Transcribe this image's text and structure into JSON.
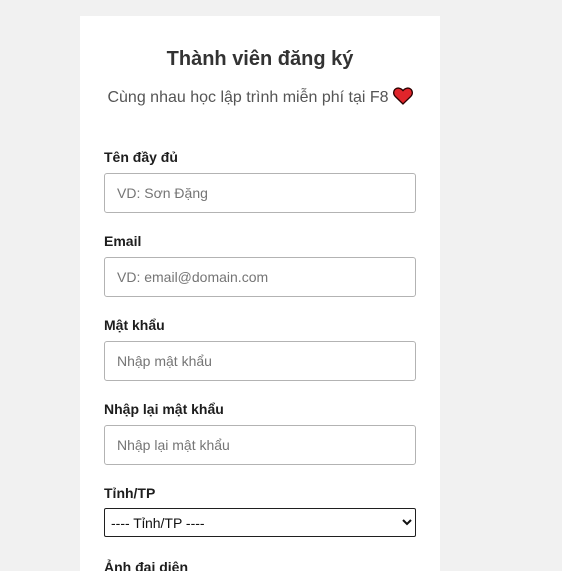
{
  "form": {
    "title": "Thành viên đăng ký",
    "subtitle": "Cùng nhau học lập trình miễn phí tại F8",
    "heart_color": "#e0252b",
    "fields": {
      "fullname": {
        "label": "Tên đầy đủ",
        "placeholder": "VD: Sơn Đặng",
        "value": ""
      },
      "email": {
        "label": "Email",
        "placeholder": "VD: email@domain.com",
        "value": ""
      },
      "password": {
        "label": "Mật khẩu",
        "placeholder": "Nhập mật khẩu",
        "value": ""
      },
      "password_confirm": {
        "label": "Nhập lại mật khẩu",
        "placeholder": "Nhập lại mật khẩu",
        "value": ""
      },
      "province": {
        "label": "Tỉnh/TP",
        "selected": "---- Tỉnh/TP ----"
      },
      "avatar": {
        "label": "Ảnh đại diện"
      }
    }
  },
  "icons": {
    "heart": "heart-icon"
  }
}
